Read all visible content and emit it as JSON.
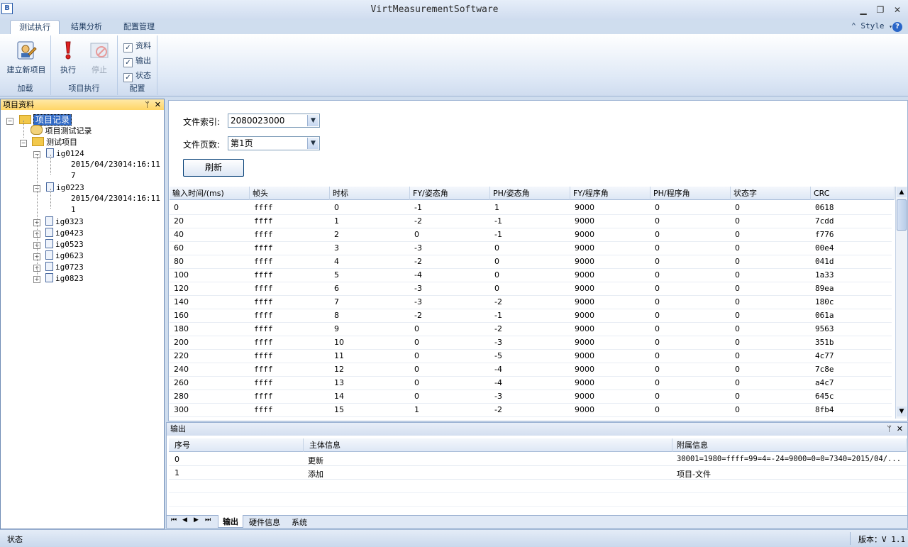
{
  "window": {
    "title": "VirtMeasurementSoftware",
    "icon_name": "app-logo-icon"
  },
  "ribbon": {
    "tabs": [
      {
        "label": "测试执行",
        "active": true
      },
      {
        "label": "结果分析",
        "active": false
      },
      {
        "label": "配置管理",
        "active": false
      }
    ],
    "style_label": "Style",
    "groups": {
      "load": {
        "label": "加载",
        "new_project": "建立新项目"
      },
      "exec": {
        "label": "项目执行",
        "run": "执行",
        "stop": "停止"
      },
      "config": {
        "label": "配置",
        "checks": [
          "资料",
          "输出",
          "状态"
        ]
      }
    }
  },
  "left_panel": {
    "title": "项目资料",
    "tree": {
      "root": "项目记录",
      "child1": "项目测试记录",
      "child2": "测试项目",
      "items": [
        {
          "name": "ig0124",
          "expanded": true,
          "sub": [
            "2015/04/23014:16:11",
            "7"
          ]
        },
        {
          "name": "ig0223",
          "expanded": true,
          "sub": [
            "2015/04/23014:16:11",
            "1"
          ]
        },
        {
          "name": "ig0323",
          "expanded": false
        },
        {
          "name": "ig0423",
          "expanded": false
        },
        {
          "name": "ig0523",
          "expanded": false
        },
        {
          "name": "ig0623",
          "expanded": false
        },
        {
          "name": "ig0723",
          "expanded": false
        },
        {
          "name": "ig0823",
          "expanded": false
        }
      ]
    }
  },
  "main": {
    "file_index_label": "文件索引:",
    "file_index_value": "2080023000",
    "file_page_label": "文件页数:",
    "file_page_value": "第1页",
    "refresh_label": "刷新",
    "grid": {
      "columns": [
        "输入时间/(ms)",
        "帧头",
        "时标",
        "FY/姿态角",
        "PH/姿态角",
        "FY/程序角",
        "PH/程序角",
        "状态字",
        "CRC"
      ],
      "rows": [
        [
          "0",
          "ffff",
          "0",
          "-1",
          "1",
          "9000",
          "0",
          "0",
          "0618"
        ],
        [
          "20",
          "ffff",
          "1",
          "-2",
          "-1",
          "9000",
          "0",
          "0",
          "7cdd"
        ],
        [
          "40",
          "ffff",
          "2",
          "0",
          "-1",
          "9000",
          "0",
          "0",
          "f776"
        ],
        [
          "60",
          "ffff",
          "3",
          "-3",
          "0",
          "9000",
          "0",
          "0",
          "00e4"
        ],
        [
          "80",
          "ffff",
          "4",
          "-2",
          "0",
          "9000",
          "0",
          "0",
          "041d"
        ],
        [
          "100",
          "ffff",
          "5",
          "-4",
          "0",
          "9000",
          "0",
          "0",
          "1a33"
        ],
        [
          "120",
          "ffff",
          "6",
          "-3",
          "0",
          "9000",
          "0",
          "0",
          "89ea"
        ],
        [
          "140",
          "ffff",
          "7",
          "-3",
          "-2",
          "9000",
          "0",
          "0",
          "180c"
        ],
        [
          "160",
          "ffff",
          "8",
          "-2",
          "-1",
          "9000",
          "0",
          "0",
          "061a"
        ],
        [
          "180",
          "ffff",
          "9",
          "0",
          "-2",
          "9000",
          "0",
          "0",
          "9563"
        ],
        [
          "200",
          "ffff",
          "10",
          "0",
          "-3",
          "9000",
          "0",
          "0",
          "351b"
        ],
        [
          "220",
          "ffff",
          "11",
          "0",
          "-5",
          "9000",
          "0",
          "0",
          "4c77"
        ],
        [
          "240",
          "ffff",
          "12",
          "0",
          "-4",
          "9000",
          "0",
          "0",
          "7c8e"
        ],
        [
          "260",
          "ffff",
          "13",
          "0",
          "-4",
          "9000",
          "0",
          "0",
          "a4c7"
        ],
        [
          "280",
          "ffff",
          "14",
          "0",
          "-3",
          "9000",
          "0",
          "0",
          "645c"
        ],
        [
          "300",
          "ffff",
          "15",
          "1",
          "-2",
          "9000",
          "0",
          "0",
          "8fb4"
        ]
      ]
    }
  },
  "output": {
    "title": "输出",
    "columns": [
      "序号",
      "主体信息",
      "附属信息"
    ],
    "rows": [
      [
        "0",
        "更新",
        "30001=1980=ffff=99=4=-24=9000=0=0=7340=2015/04/..."
      ],
      [
        "1",
        "添加",
        "项目-文件"
      ]
    ],
    "tabs": [
      "输出",
      "硬件信息",
      "系统"
    ]
  },
  "statusbar": {
    "left": "状态",
    "right": "版本：V 1.1"
  }
}
